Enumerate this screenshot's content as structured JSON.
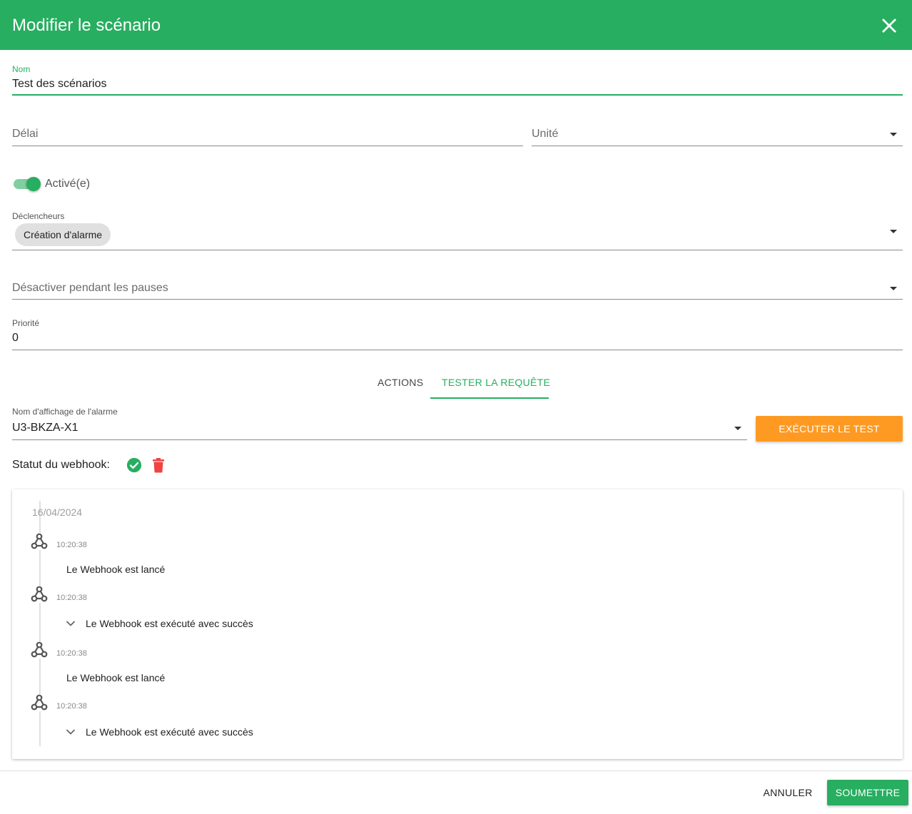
{
  "dialog": {
    "title": "Modifier le scénario"
  },
  "form": {
    "name": {
      "label": "Nom",
      "value": "Test des scénarios"
    },
    "delay": {
      "label": "Délai",
      "value": ""
    },
    "unit": {
      "label": "Unité",
      "value": ""
    },
    "enabled": {
      "label": "Activé(e)",
      "checked": true
    },
    "triggers": {
      "label": "Déclencheurs",
      "chips": [
        "Création d'alarme"
      ]
    },
    "disable_during_pauses": {
      "label": "Désactiver pendant les pauses",
      "value": ""
    },
    "priority": {
      "label": "Priorité",
      "value": "0"
    }
  },
  "tabs": [
    {
      "label": "ACTIONS",
      "active": false
    },
    {
      "label": "TESTER LA REQUÊTE",
      "active": true
    }
  ],
  "test": {
    "alarm_label": "Nom d'affichage de l'alarme",
    "alarm_value": "U3-BKZA-X1",
    "run_button": "EXÉCUTER LE TEST",
    "webhook_status_label": "Statut du webhook:"
  },
  "timeline": {
    "date": "16/04/2024",
    "events": [
      {
        "time": "10:20:38",
        "message": "Le Webhook est lancé",
        "expandable": false,
        "icon": "webhook-icon"
      },
      {
        "time": "10:20:38",
        "message": "Le Webhook est exécuté avec succès",
        "expandable": true,
        "icon": "webhook-icon"
      },
      {
        "time": "10:20:38",
        "message": "Le Webhook est lancé",
        "expandable": false,
        "icon": "webhook-icon"
      },
      {
        "time": "10:20:38",
        "message": "Le Webhook est exécuté avec succès",
        "expandable": true,
        "icon": "webhook-icon"
      }
    ]
  },
  "footer": {
    "cancel": "ANNULER",
    "submit": "SOUMETTRE"
  },
  "colors": {
    "primary": "#27ae60",
    "accent": "#fe9a22",
    "danger": "#ef4444"
  }
}
